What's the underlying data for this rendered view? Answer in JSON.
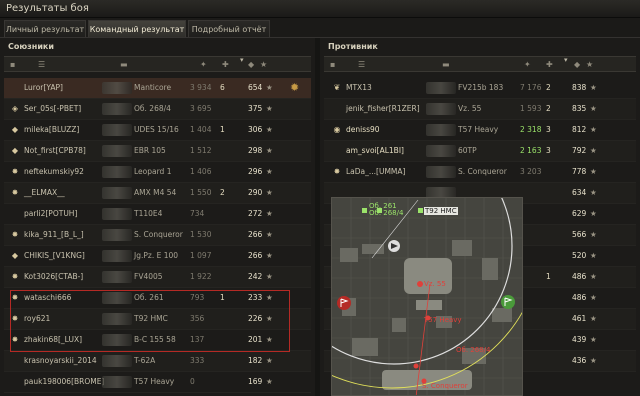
{
  "window": {
    "title": "Результаты боя"
  },
  "tabs": [
    {
      "label": "Личный результат",
      "active": false
    },
    {
      "label": "Командный результат",
      "active": true
    },
    {
      "label": "Подробный отчёт",
      "active": false
    }
  ],
  "allies": {
    "title": "Союзники",
    "rows": [
      {
        "icon": "",
        "name": "Luror[YAP]",
        "tank": "Manticore",
        "damage": "3 934",
        "kills": "6",
        "xp": "654",
        "medal": true,
        "highlight": true
      },
      {
        "icon": "rank-icon",
        "name": "Ser_05s[-PBET]",
        "tank": "Об. 268/4",
        "damage": "3 695",
        "kills": "",
        "xp": "375"
      },
      {
        "icon": "diamond-rank-icon",
        "name": "mileka[BLUZZ]",
        "tank": "UDES 15/16",
        "damage": "1 404",
        "kills": "1",
        "xp": "306"
      },
      {
        "icon": "diamond-rank-icon",
        "name": "Not_first[CPB78]",
        "tank": "EBR 105",
        "damage": "1 512",
        "kills": "",
        "xp": "298"
      },
      {
        "icon": "star-rank-icon",
        "name": "neftekumskiy92",
        "tank": "Leopard 1",
        "damage": "1 406",
        "kills": "",
        "xp": "296"
      },
      {
        "icon": "star-rank-icon",
        "name": "__ELMAX__",
        "tank": "AMX M4 54",
        "damage": "1 550",
        "kills": "2",
        "xp": "290"
      },
      {
        "icon": "",
        "name": "parli2[POTUH]",
        "tank": "T110E4",
        "damage": "734",
        "kills": "",
        "xp": "272"
      },
      {
        "icon": "star-rank-icon",
        "name": "kika_911_[B_L_]",
        "tank": "S. Conqueror",
        "damage": "1 530",
        "kills": "",
        "xp": "266"
      },
      {
        "icon": "diamond-rank-icon",
        "name": "CHIKIS_[V1KNG]",
        "tank": "Jg.Pz. E 100",
        "damage": "1 097",
        "kills": "",
        "xp": "266"
      },
      {
        "icon": "star-rank-icon",
        "name": "Kot3026[CTAB-]",
        "tank": "FV4005",
        "damage": "1 922",
        "kills": "",
        "xp": "242"
      },
      {
        "icon": "star-rank-icon",
        "name": "wataschi666",
        "tank": "Об. 261",
        "damage": "793",
        "kills": "1",
        "xp": "233"
      },
      {
        "icon": "star-rank-icon",
        "name": "roy621",
        "tank": "T92 HMC",
        "damage": "356",
        "kills": "",
        "xp": "226"
      },
      {
        "icon": "star-rank-icon",
        "name": "zhakin68[_LUX]",
        "tank": "B-C 155 58",
        "damage": "137",
        "kills": "",
        "xp": "201"
      },
      {
        "icon": "",
        "name": "krasnoyarskii_2014",
        "tank": "T-62A",
        "damage": "333",
        "kills": "",
        "xp": "182"
      },
      {
        "icon": "",
        "name": "pauk198006[BROME]",
        "tank": "T57 Heavy",
        "damage": "0",
        "kills": "",
        "xp": "169"
      }
    ]
  },
  "enemies": {
    "title": "Противник",
    "rows": [
      {
        "icon": "wreath-icon",
        "name": "MTX13",
        "tank": "FV215b 183",
        "damage": "7 176",
        "kills": "2",
        "xp": "838"
      },
      {
        "icon": "",
        "name": "jenik_fisher[R1ZER]",
        "tank": "Vz. 55",
        "damage": "1 593",
        "kills": "2",
        "xp": "835"
      },
      {
        "icon": "globe-icon",
        "name": "deniss90",
        "tank": "T57 Heavy",
        "damage": "2 318",
        "kills": "3",
        "xp": "812",
        "green": true
      },
      {
        "icon": "",
        "name": "am_svoi[AL1BI]",
        "tank": "60TP",
        "damage": "2 163",
        "kills": "3",
        "xp": "792",
        "green": true
      },
      {
        "icon": "star-rank-icon",
        "name": "LaDa_...[UMMA]",
        "tank": "S. Conqueror",
        "damage": "3 203",
        "kills": "",
        "xp": "778"
      },
      {
        "icon": "",
        "name": "",
        "tank": "",
        "damage": "",
        "kills": "",
        "xp": "634"
      },
      {
        "icon": "",
        "name": "",
        "tank": "",
        "damage": "",
        "kills": "",
        "xp": "629"
      },
      {
        "icon": "",
        "name": "",
        "tank": "",
        "damage": "",
        "kills": "",
        "xp": "566"
      },
      {
        "icon": "",
        "name": "",
        "tank": "",
        "damage": "",
        "kills": "",
        "xp": "520"
      },
      {
        "icon": "",
        "name": "",
        "tank": "",
        "damage": "",
        "kills": "1",
        "xp": "486"
      },
      {
        "icon": "",
        "name": "",
        "tank": "",
        "damage": "",
        "kills": "",
        "xp": "486"
      },
      {
        "icon": "",
        "name": "",
        "tank": "",
        "damage": "",
        "kills": "",
        "xp": "461"
      },
      {
        "icon": "",
        "name": "",
        "tank": "",
        "damage": "",
        "kills": "",
        "xp": "439"
      },
      {
        "icon": "",
        "name": "",
        "tank": "",
        "damage": "",
        "kills": "",
        "xp": "436"
      }
    ]
  },
  "minimap": {
    "labels": {
      "top1": "Об. 261",
      "top2": "Об. 268/4",
      "top3": "T92 HMC",
      "vz": "Vz. 55",
      "heavy": "T57 Heavy",
      "ob": "Об. 268/4",
      "sconq": "S. Conqueror"
    }
  },
  "colors": {
    "accent": "#c79a45",
    "highlight_box": "#b52a25",
    "ally": "#9be36a",
    "enemy": "#e0403a"
  }
}
